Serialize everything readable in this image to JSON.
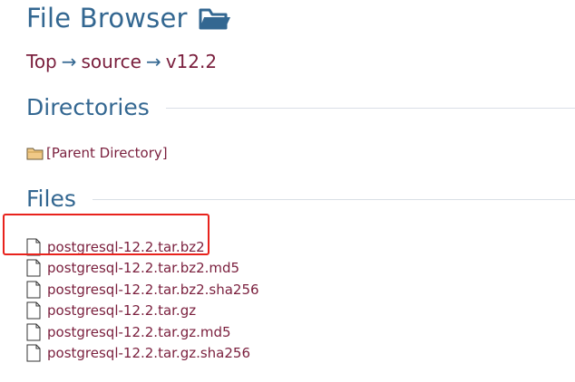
{
  "header": {
    "title": "File Browser",
    "title_icon": "folder-open-icon"
  },
  "breadcrumb": {
    "items": [
      "Top",
      "source",
      "v12.2"
    ],
    "separator": "→"
  },
  "directories": {
    "heading": "Directories",
    "parent_label": "[Parent Directory]",
    "parent_icon": "folder-icon"
  },
  "files": {
    "heading": "Files",
    "items": [
      "postgresql-12.2.tar.bz2",
      "postgresql-12.2.tar.bz2.md5",
      "postgresql-12.2.tar.bz2.sha256",
      "postgresql-12.2.tar.gz",
      "postgresql-12.2.tar.gz.md5",
      "postgresql-12.2.tar.gz.sha256"
    ],
    "file_icon": "file-icon",
    "highlighted_index": 0
  },
  "colors": {
    "heading_blue": "#336791",
    "link_maroon": "#7a1f3d",
    "highlight_red": "#e8221c"
  }
}
